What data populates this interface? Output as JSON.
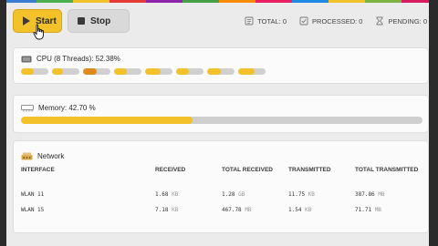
{
  "colors": {
    "accent": "#f3c22b",
    "accent_hot": "#e08a1e",
    "track": "#d0d0d0",
    "stripe": [
      "#3a7bd5",
      "#4caf50",
      "#f3c22b",
      "#e53935",
      "#8e24aa",
      "#43a047",
      "#fb8c00",
      "#e91e63",
      "#1e88e5",
      "#f3c22b",
      "#7cb342",
      "#d81b60"
    ]
  },
  "toolbar": {
    "start_label": "Start",
    "stop_label": "Stop"
  },
  "stats": {
    "total": "TOTAL: 0",
    "processed": "PROCESSED: 0",
    "pending": "PENDING: 0"
  },
  "cpu": {
    "title": "CPU (8 Threads): 52.38%",
    "cores": [
      {
        "level": 0.45,
        "hot": false
      },
      {
        "level": 0.4,
        "hot": false
      },
      {
        "level": 0.5,
        "hot": true
      },
      {
        "level": 0.45,
        "hot": false
      },
      {
        "level": 0.55,
        "hot": false
      },
      {
        "level": 0.45,
        "hot": false
      },
      {
        "level": 0.5,
        "hot": false
      },
      {
        "level": 0.6,
        "hot": false
      }
    ]
  },
  "memory": {
    "title": "Memory: 42.70 %",
    "level": 0.427
  },
  "network": {
    "title": "Network",
    "headers": [
      "INTERFACE",
      "RECEIVED",
      "TOTAL RECEIVED",
      "TRANSMITTED",
      "TOTAL TRANSMITTED"
    ],
    "rows": [
      {
        "interface": "WLAN 11",
        "received": "1.68",
        "received_unit": "KB",
        "total_received": "1.28",
        "total_received_unit": "GB",
        "transmitted": "11.75",
        "transmitted_unit": "KB",
        "total_transmitted": "387.86",
        "total_transmitted_unit": "MB"
      },
      {
        "interface": "WLAN 15",
        "received": "7.18",
        "received_unit": "KB",
        "total_received": "467.78",
        "total_received_unit": "MB",
        "transmitted": "1.54",
        "transmitted_unit": "KB",
        "total_transmitted": "71.71",
        "total_transmitted_unit": "MB"
      }
    ]
  }
}
